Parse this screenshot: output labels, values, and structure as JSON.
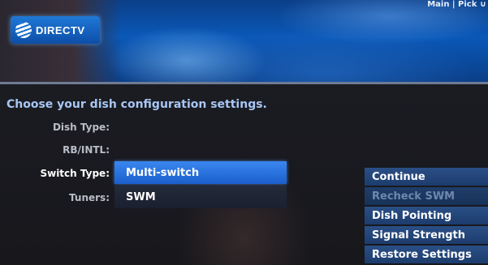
{
  "header": {
    "brand": "DIRECTV",
    "top_info": "Main | Pick ∪"
  },
  "prompt": "Choose your dish configuration settings.",
  "form": {
    "dish_type": {
      "label": "Dish Type:",
      "value": ""
    },
    "rb_intl": {
      "label": "RB/INTL:",
      "value": ""
    },
    "switch_type": {
      "label": "Switch Type:",
      "value": "Multi-switch"
    },
    "tuners": {
      "label": "Tuners:",
      "value": "SWM"
    }
  },
  "menu": {
    "items": [
      {
        "label": "Continue",
        "state": "enabled"
      },
      {
        "label": "Recheck SWM",
        "state": "disabled"
      },
      {
        "label": "Dish Pointing",
        "state": "enabled"
      },
      {
        "label": "Signal Strength",
        "state": "enabled"
      },
      {
        "label": "Restore Settings",
        "state": "enabled"
      }
    ]
  },
  "colors": {
    "accent": "#2f7be6",
    "menu_bg": "#244778",
    "prompt_text": "#a8c6f4"
  }
}
